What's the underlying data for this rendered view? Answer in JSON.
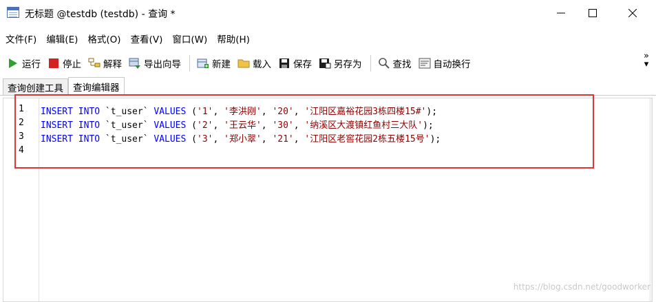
{
  "window": {
    "title": "无标题 @testdb (testdb) - 查询 *"
  },
  "menu": {
    "items": [
      "文件(F)",
      "编辑(E)",
      "格式(O)",
      "查看(V)",
      "窗口(W)",
      "帮助(H)"
    ]
  },
  "toolbar": {
    "run": "运行",
    "stop": "停止",
    "explain": "解释",
    "export_wizard": "导出向导",
    "new": "新建",
    "load": "载入",
    "save": "保存",
    "save_as": "另存为",
    "find": "查找",
    "word_wrap": "自动换行",
    "overflow": "»"
  },
  "tabs": {
    "query_builder": "查询创建工具",
    "query_editor": "查询编辑器"
  },
  "editor": {
    "line_numbers": [
      "1",
      "2",
      "3",
      "4"
    ],
    "lines": [
      {
        "kw1": "INSERT INTO",
        "table": " `t_user` ",
        "kw2": "VALUES",
        "open": " (",
        "v1": "'1'",
        "v2": "'李洪刚'",
        "v3": "'20'",
        "v4": "'江阳区嘉裕花园3栋四楼15#'",
        "close": ");"
      },
      {
        "kw1": "INSERT INTO",
        "table": " `t_user` ",
        "kw2": "VALUES",
        "open": " (",
        "v1": "'2'",
        "v2": "'王云华'",
        "v3": "'30'",
        "v4": "'纳溪区大渡镇红鱼村三大队'",
        "close": ");"
      },
      {
        "kw1": "INSERT INTO",
        "table": " `t_user` ",
        "kw2": "VALUES",
        "open": " (",
        "v1": "'3'",
        "v2": "'郑小翠'",
        "v3": "'21'",
        "v4": "'江阳区老窖花园2栋五楼15号'",
        "close": ");"
      }
    ]
  },
  "watermark": "https://blog.csdn.net/goodworker",
  "colors": {
    "keyword": "#0000ff",
    "string": "#8b0000",
    "highlight": "#e03434"
  }
}
